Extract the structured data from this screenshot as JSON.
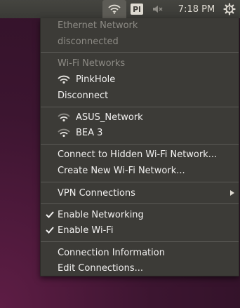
{
  "panel": {
    "keyboard_indicator": "Pl",
    "clock": "7:18 PM",
    "icons": [
      "wifi-icon",
      "keyboard-layout-icon",
      "volume-muted-icon",
      "power-gear-icon"
    ]
  },
  "menu": {
    "ethernet_header": "Ethernet Network",
    "ethernet_status": "disconnected",
    "wifi_header": "Wi-Fi Networks",
    "connected_network": "PinkHole",
    "disconnect_label": "Disconnect",
    "available_networks": [
      "ASUS_Network",
      "BEA 3"
    ],
    "connect_hidden_label": "Connect to Hidden Wi-Fi Network...",
    "create_new_label": "Create New Wi-Fi Network...",
    "vpn_label": "VPN Connections",
    "enable_networking_label": "Enable Networking",
    "enable_wifi_label": "Enable Wi-Fi",
    "connection_info_label": "Connection Information",
    "edit_connections_label": "Edit Connections...",
    "enable_networking_checked": true,
    "enable_wifi_checked": true
  }
}
